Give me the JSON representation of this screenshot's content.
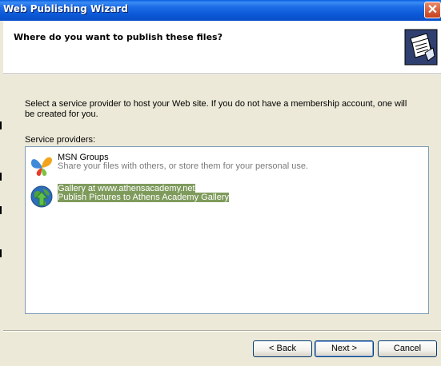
{
  "window": {
    "title": "Web Publishing Wizard",
    "close_glyph": "✕"
  },
  "header": {
    "title": "Where do you want to publish these files?",
    "icon": "publishing-wizard-icon"
  },
  "body": {
    "description": "Select a service provider to host your Web site.  If you do not have a membership account, one will be created for you.",
    "providers_label": "Service providers:"
  },
  "providers": [
    {
      "name": "MSN Groups",
      "description": "Share your files with others, or store them for your personal use.",
      "icon": "msn-butterfly-icon",
      "selected": false
    },
    {
      "name": "Gallery at www.athensacademy.net",
      "description": "Publish Pictures to Athens Academy Gallery",
      "icon": "globe-upload-icon",
      "selected": true
    }
  ],
  "buttons": {
    "back": "< Back",
    "next": "Next >",
    "cancel": "Cancel"
  }
}
